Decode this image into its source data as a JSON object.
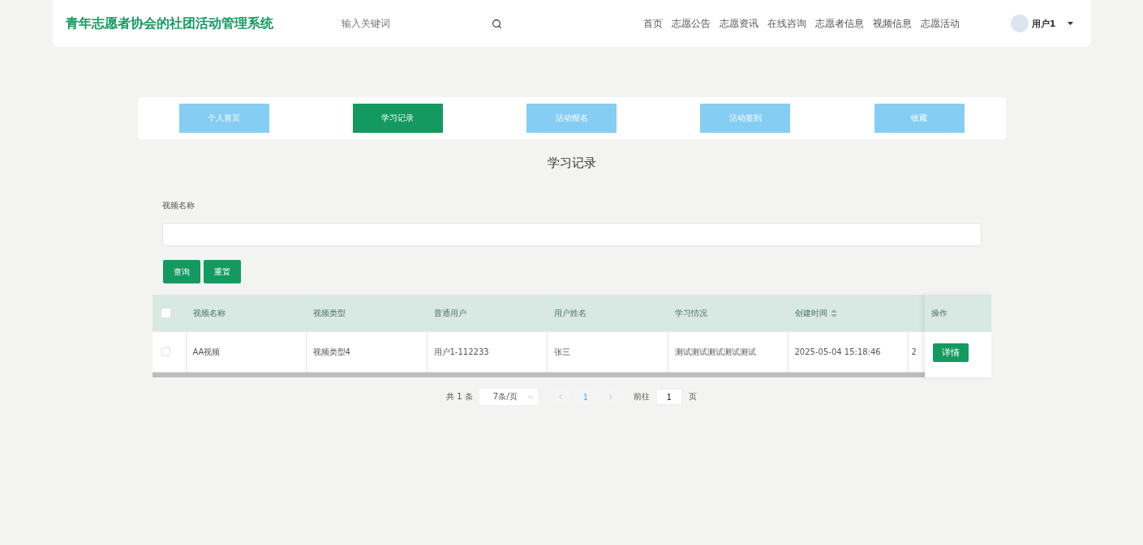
{
  "header": {
    "title": "青年志愿者协会的社团活动管理系统",
    "search": {
      "placeholder": "输入关键词"
    },
    "nav": [
      "首页",
      "志愿公告",
      "志愿资讯",
      "在线咨询",
      "志愿者信息",
      "视频信息",
      "志愿活动"
    ],
    "user": {
      "name": "用户1"
    }
  },
  "tabs": [
    {
      "label": "个人首页",
      "selected": false
    },
    {
      "label": "学习记录",
      "selected": true
    },
    {
      "label": "活动报名",
      "selected": false
    },
    {
      "label": "活动签到",
      "selected": false
    },
    {
      "label": "收藏",
      "selected": false
    }
  ],
  "page_title": "学习记录",
  "filter": {
    "label": "视频名称",
    "buttons": [
      "查询",
      "重置"
    ]
  },
  "table": {
    "select_all": {
      "checked": false
    },
    "columns": [
      {
        "label": "视频名称",
        "sortable": false
      },
      {
        "label": "视频类型",
        "sortable": false
      },
      {
        "label": "普通用户",
        "sortable": false
      },
      {
        "label": "用户姓名",
        "sortable": false
      },
      {
        "label": "学习情况",
        "sortable": false
      },
      {
        "label": "创建时间",
        "sortable": true
      }
    ],
    "action_column": "操作",
    "rows": [
      {
        "checked": false,
        "cells": [
          "AA视频",
          "视频类型4",
          "用户1-112233",
          "张三",
          "测试测试测试测试测试",
          "2025-05-04 15:18:46"
        ],
        "column_7": "2",
        "action": "详情"
      }
    ]
  },
  "pagination": {
    "total": "共 1 条",
    "page_size": "7条/页",
    "pages": [
      {
        "label": "1",
        "selected": true
      }
    ],
    "goto_label": "前往",
    "goto_value": "1",
    "goto_suffix": "页"
  }
}
